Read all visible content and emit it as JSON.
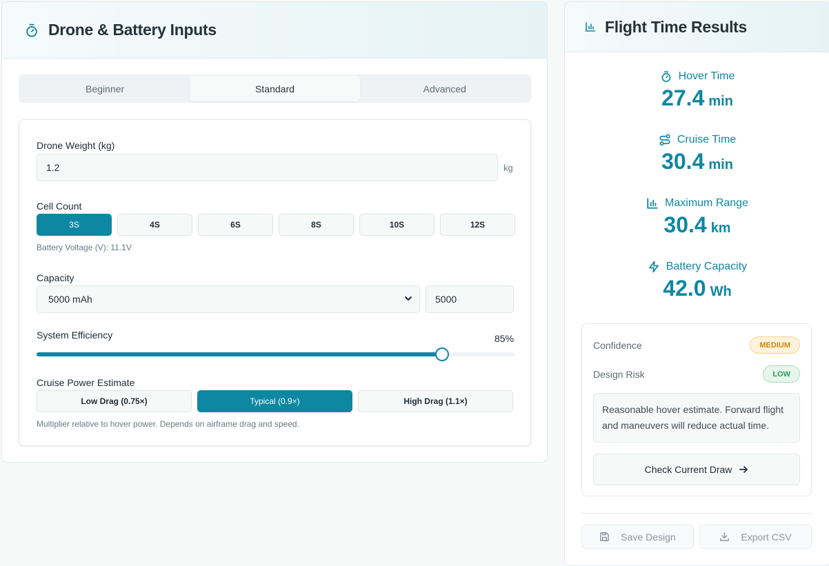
{
  "inputs_panel": {
    "title": "Drone & Battery Inputs",
    "icon": "stopwatch-icon",
    "mode_tabs": [
      {
        "label": "Beginner",
        "active": false
      },
      {
        "label": "Standard",
        "active": true
      },
      {
        "label": "Advanced",
        "active": false
      }
    ],
    "drone_weight": {
      "label": "Drone Weight (kg)",
      "value": "1.2",
      "unit": "kg"
    },
    "cell_count": {
      "label": "Cell Count",
      "options": [
        "3S",
        "4S",
        "6S",
        "8S",
        "10S",
        "12S"
      ],
      "selected": "3S",
      "hint": "Battery Voltage (V): 11.1V"
    },
    "capacity": {
      "label": "Capacity",
      "selected_option": "5000 mAh",
      "value": "5000"
    },
    "efficiency": {
      "label": "System Efficiency",
      "value_label": "85%",
      "value": 0.85
    },
    "cruise_power": {
      "label": "Cruise Power Estimate",
      "options": [
        "Low Drag (0.75×)",
        "Typical (0.9×)",
        "High Drag (1.1×)"
      ],
      "selected": "Typical (0.9×)",
      "hint": "Multiplier relative to hover power. Depends on airframe drag and speed."
    }
  },
  "results_panel": {
    "title": "Flight Time Results",
    "icon": "bar-chart-icon",
    "metrics": [
      {
        "label": "Hover Time",
        "value": "27.4",
        "unit": "min",
        "icon": "stopwatch-icon"
      },
      {
        "label": "Cruise Time",
        "value": "30.4",
        "unit": "min",
        "icon": "route-icon"
      },
      {
        "label": "Maximum Range",
        "value": "30.4",
        "unit": "km",
        "icon": "bar-chart-icon"
      },
      {
        "label": "Battery Capacity",
        "value": "42.0",
        "unit": "Wh",
        "icon": "lightning-icon"
      }
    ],
    "assessment": {
      "confidence_label": "Confidence",
      "confidence_value": "MEDIUM",
      "risk_label": "Design Risk",
      "risk_value": "LOW",
      "note": "Reasonable hover estimate. Forward flight and maneuvers will reduce actual time.",
      "check_button": "Check Current Draw"
    },
    "save_button": "Save Design",
    "export_button": "Export CSV"
  },
  "colors": {
    "accent": "#0e87a3",
    "medium_badge": "#c98a09",
    "low_badge": "#2a9d55"
  }
}
